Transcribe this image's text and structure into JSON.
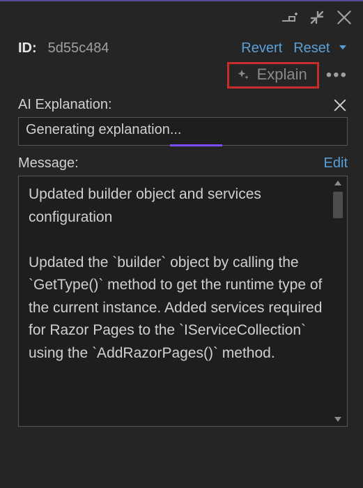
{
  "header": {
    "id_label": "ID:",
    "id_value": "5d55c484",
    "revert": "Revert",
    "reset": "Reset"
  },
  "explain": {
    "label": "Explain"
  },
  "ai": {
    "section_label": "AI Explanation:",
    "status_text": "Generating explanation..."
  },
  "message": {
    "section_label": "Message:",
    "edit": "Edit",
    "body": "Updated builder object and services configuration\n\nUpdated the `builder` object by calling the `GetType()` method to get the runtime type of the current instance. Added services required for Razor Pages to the `IServiceCollection` using the `AddRazorPages()` method."
  }
}
